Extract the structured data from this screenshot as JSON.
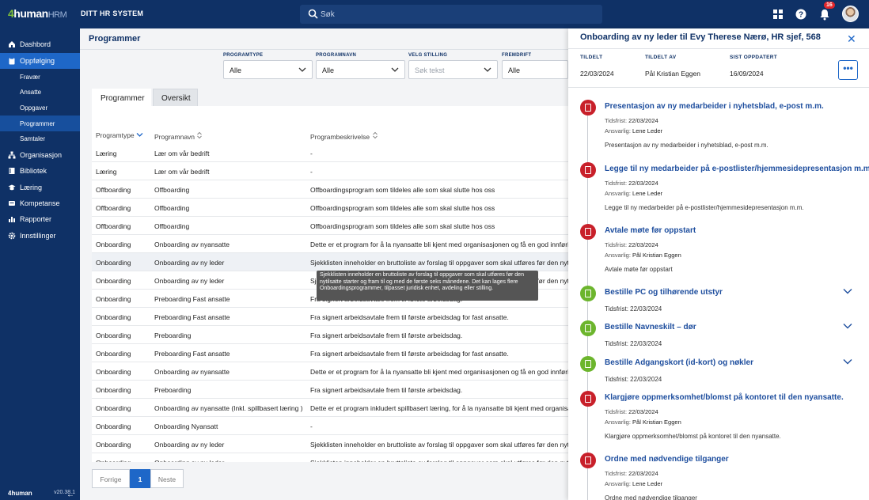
{
  "topbar": {
    "logo_num": "4",
    "logo_text": "human",
    "logo_suffix": "HRM",
    "system_name": "DITT HR SYSTEM",
    "search_placeholder": "Søk",
    "notification_count": "16",
    "icons": [
      "grid-icon",
      "help-icon",
      "bell-icon"
    ]
  },
  "sidebar": {
    "items": [
      {
        "label": "Dashbord",
        "icon": "home-icon"
      },
      {
        "label": "Oppfølging",
        "icon": "clipboard-icon"
      },
      {
        "label": "Fravær"
      },
      {
        "label": "Ansatte"
      },
      {
        "label": "Oppgaver"
      },
      {
        "label": "Programmer"
      },
      {
        "label": "Samtaler"
      },
      {
        "label": "Organisasjon",
        "icon": "org-icon"
      },
      {
        "label": "Bibliotek",
        "icon": "book-icon"
      },
      {
        "label": "Læring",
        "icon": "learning-icon"
      },
      {
        "label": "Kompetanse",
        "icon": "competence-icon"
      },
      {
        "label": "Rapporter",
        "icon": "chart-icon"
      },
      {
        "label": "Innstillinger",
        "icon": "gear-icon"
      }
    ],
    "footer_logo": "4human",
    "version": "v20.38.1"
  },
  "main": {
    "title": "Programmer",
    "filters": [
      {
        "label": "PROGRAMTYPE",
        "value": "Alle"
      },
      {
        "label": "PROGRAMNAVN",
        "value": "Alle"
      },
      {
        "label": "VELG STILLING",
        "placeholder": "Søk tekst"
      },
      {
        "label": "FREMDRIFT",
        "value": "Alle"
      }
    ],
    "tabs": [
      "Programmer",
      "Oversikt"
    ],
    "columns": [
      "Programtype",
      "Programnavn",
      "Programbeskrivelse"
    ],
    "rows": [
      [
        "Læring",
        "Lær om vår bedrift",
        "-"
      ],
      [
        "Læring",
        "Lær om vår bedrift",
        "-"
      ],
      [
        "Offboarding",
        "Offboarding",
        "Offboardingsprogram som tildeles alle som skal slutte hos oss"
      ],
      [
        "Offboarding",
        "Offboarding",
        "Offboardingsprogram som tildeles alle som skal slutte hos oss"
      ],
      [
        "Offboarding",
        "Offboarding",
        "Offboardingsprogram som tildeles alle som skal slutte hos oss"
      ],
      [
        "Onboarding",
        "Onboarding av nyansatte",
        "Dette er et program for å la nyansatte bli kjent med organisasjonen og få en god innføring"
      ],
      [
        "Onboarding",
        "Onboarding av ny leder",
        "Sjekklisten inneholder en bruttoliste av forslag til oppgaver som skal utføres før den nytilsatte"
      ],
      [
        "Onboarding",
        "Onboarding av ny leder",
        "Sjekklisten inneholder en bruttoliste av forslag til oppgaver som skal utføres før den nytilsatte"
      ],
      [
        "Onboarding",
        "Preboarding Fast ansatte",
        "Fra signert arbeidsavtale frem til første arbeidsdag."
      ],
      [
        "Onboarding",
        "Preboarding Fast ansatte",
        "Fra signert arbeidsavtale frem til første arbeidsdag for fast ansatte."
      ],
      [
        "Onboarding",
        "Preboarding",
        "Fra signert arbeidsavtale frem til første arbeidsdag."
      ],
      [
        "Onboarding",
        "Preboarding Fast ansatte",
        "Fra signert arbeidsavtale frem til første arbeidsdag for fast ansatte."
      ],
      [
        "Onboarding",
        "Onboarding av nyansatte",
        "Dette er et program for å la nyansatte bli kjent med organisasjonen og få en god innføring"
      ],
      [
        "Onboarding",
        "Preboarding",
        "Fra signert arbeidsavtale frem til første arbeidsdag."
      ],
      [
        "Onboarding",
        "Onboarding av nyansatte (Inkl. spillbasert læring )",
        "Dette er et program inkludert spillbasert læring, for å la nyansatte bli kjent med organisasjonen"
      ],
      [
        "Onboarding",
        "Onboarding Nyansatt",
        "-"
      ],
      [
        "Onboarding",
        "Onboarding av ny leder",
        "Sjekklisten inneholder en bruttoliste av forslag til oppgaver som skal utføres før den nytilsatte"
      ],
      [
        "Onboarding",
        "Onboarding av ny leder",
        "Sjekklisten inneholder en bruttoliste av forslag til oppgaver som skal utføres før den nytilsatte"
      ]
    ],
    "tooltip": "Sjekklisten inneholder en bruttoliste av forslag til oppgaver som skal utføres før den nytilsatte starter og fram til og med de første seks månedene. Det kan lages flere Onboardingsprogrammer, tilpasset juridisk enhet, avdeling eller stilling.",
    "pager": {
      "prev": "Forrige",
      "current": "1",
      "next": "Neste"
    }
  },
  "panel": {
    "title": "Onboarding av ny leder til Evy Therese Nærø, HR sjef, 568",
    "meta": [
      {
        "label": "TILDELT",
        "value": "22/03/2024"
      },
      {
        "label": "TILDELT AV",
        "value": "Pål Kristian Eggen"
      },
      {
        "label": "SIST OPPDATERT",
        "value": "16/09/2024"
      }
    ],
    "more_label": "•••",
    "due_label": "Tidsfrist:",
    "resp_label": "Ansvarlig:",
    "tasks": [
      {
        "title": "Presentasjon av ny medarbeider i nyhetsblad, e-post m.m.",
        "status": "red",
        "due": "22/03/2024",
        "responsible": "Lene Leder",
        "description": "Presentasjon av ny medarbeider i nyhetsblad, e-post m.m."
      },
      {
        "title": "Legge til ny medarbeider på e-postlister/hjemmesidepresentasjon m.m.",
        "status": "red",
        "due": "22/03/2024",
        "responsible": "Lene Leder",
        "description": "Legge til ny medarbeider på e-postlister/hjemmesidepresentasjon m.m."
      },
      {
        "title": "Avtale møte før oppstart",
        "status": "red",
        "due": "22/03/2024",
        "responsible": "Pål Kristian Eggen",
        "description": "Avtale møte før oppstart"
      },
      {
        "title": "Bestille PC og tilhørende utstyr",
        "status": "green",
        "due": "22/03/2024"
      },
      {
        "title": "Bestille Navneskilt – dør",
        "status": "green",
        "due": "22/03/2024"
      },
      {
        "title": "Bestille Adgangskort (id-kort) og nøkler",
        "status": "green",
        "due": "22/03/2024"
      },
      {
        "title": "Klargjøre oppmerksomhet/blomst på kontoret til den nyansatte.",
        "status": "red",
        "due": "22/03/2024",
        "responsible": "Pål Kristian Eggen",
        "description": "Klargjøre oppmerksomhet/blomst på kontoret til den nyansatte."
      },
      {
        "title": "Ordne med nødvendige tilganger",
        "status": "red",
        "due": "22/03/2024",
        "responsible": "Lene Leder",
        "description": "Ordne med nødvendige tilganger"
      }
    ]
  }
}
